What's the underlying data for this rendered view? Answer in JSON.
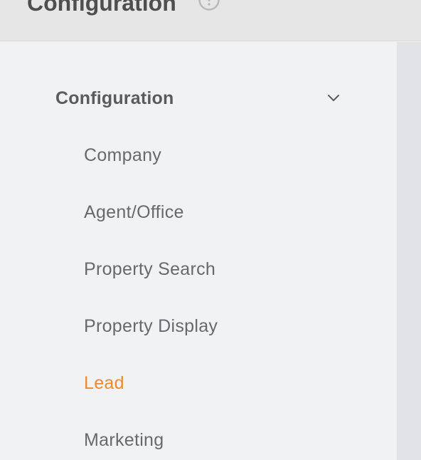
{
  "header": {
    "title": "Configuration",
    "help_icon": "help-circle-icon"
  },
  "sidebar": {
    "section": {
      "title": "Configuration",
      "expanded": true,
      "toggle_icon": "chevron-down-icon"
    },
    "items": [
      {
        "label": "Company",
        "active": false
      },
      {
        "label": "Agent/Office",
        "active": false
      },
      {
        "label": "Property Search",
        "active": false
      },
      {
        "label": "Property Display",
        "active": false
      },
      {
        "label": "Lead",
        "active": true
      },
      {
        "label": "Marketing",
        "active": false
      }
    ]
  },
  "colors": {
    "active": "#ec8a2c",
    "text": "#666a6e",
    "heading": "#5b5b5b",
    "header_bg": "#e6e6e6",
    "sidebar_bg": "#f1f2f4",
    "right_panel_bg": "#e1e3e6"
  }
}
